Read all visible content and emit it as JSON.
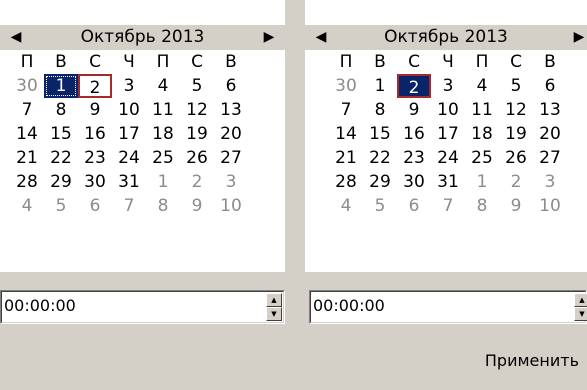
{
  "left_calendar": {
    "month_title": "Октябрь 2013",
    "prev_glyph": "◀",
    "next_glyph": "▶",
    "weekdays": [
      "П",
      "В",
      "С",
      "Ч",
      "П",
      "С",
      "В"
    ],
    "weeks": [
      [
        "30",
        "1",
        "2",
        "3",
        "4",
        "5",
        "6"
      ],
      [
        "7",
        "8",
        "9",
        "10",
        "11",
        "12",
        "13"
      ],
      [
        "14",
        "15",
        "16",
        "17",
        "18",
        "19",
        "20"
      ],
      [
        "21",
        "22",
        "23",
        "24",
        "25",
        "26",
        "27"
      ],
      [
        "28",
        "29",
        "30",
        "31",
        "1",
        "2",
        "3"
      ],
      [
        "4",
        "5",
        "6",
        "7",
        "8",
        "9",
        "10"
      ]
    ],
    "selected_day": "1",
    "today_day": "2"
  },
  "right_calendar": {
    "month_title": "Октябрь 2013",
    "prev_glyph": "◀",
    "next_glyph": "▶",
    "weekdays": [
      "П",
      "В",
      "С",
      "Ч",
      "П",
      "С",
      "В"
    ],
    "weeks": [
      [
        "30",
        "1",
        "2",
        "3",
        "4",
        "5",
        "6"
      ],
      [
        "7",
        "8",
        "9",
        "10",
        "11",
        "12",
        "13"
      ],
      [
        "14",
        "15",
        "16",
        "17",
        "18",
        "19",
        "20"
      ],
      [
        "21",
        "22",
        "23",
        "24",
        "25",
        "26",
        "27"
      ],
      [
        "28",
        "29",
        "30",
        "31",
        "1",
        "2",
        "3"
      ],
      [
        "4",
        "5",
        "6",
        "7",
        "8",
        "9",
        "10"
      ]
    ],
    "selected_day": "2"
  },
  "left_time": {
    "value": "00:00:00"
  },
  "right_time": {
    "value": "00:00:00"
  },
  "apply_label": "Применить",
  "colors": {
    "selection": "#0a246a",
    "today_border": "#a52a2a",
    "face": "#d4d0c8",
    "other_month": "#8c8c8c"
  }
}
